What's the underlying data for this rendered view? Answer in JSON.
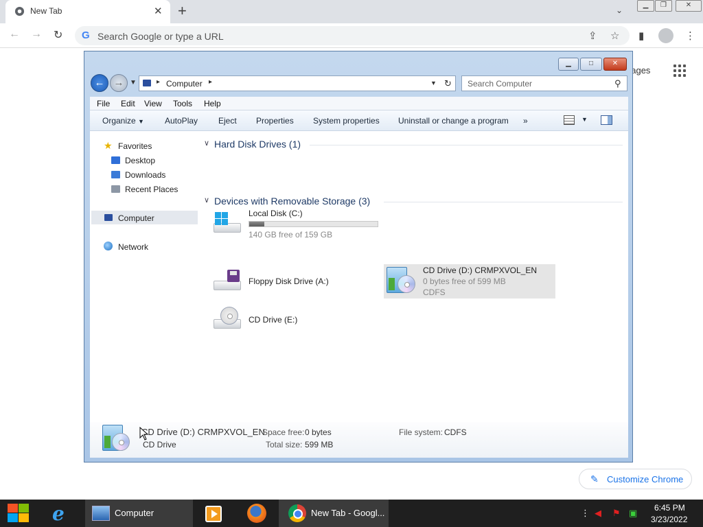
{
  "browser": {
    "tab_title": "New Tab",
    "omnibox_placeholder": "Search Google or type a URL",
    "ntp_images_link": "nages",
    "customize_label": "Customize Chrome"
  },
  "explorer": {
    "address_text": "Computer",
    "search_placeholder": "Search Computer",
    "menu": [
      "File",
      "Edit",
      "View",
      "Tools",
      "Help"
    ],
    "commands": [
      "Organize",
      "AutoPlay",
      "Eject",
      "Properties",
      "System properties",
      "Uninstall or change a program",
      "»"
    ],
    "nav": {
      "favorites": "Favorites",
      "desktop": "Desktop",
      "downloads": "Downloads",
      "recent": "Recent Places",
      "computer": "Computer",
      "network": "Network"
    },
    "groups": {
      "hard_disks": "Hard Disk Drives (1)",
      "removable": "Devices with Removable Storage (3)"
    },
    "drives": {
      "c_name": "Local Disk (C:)",
      "c_free": "140 GB free of 159 GB",
      "c_used_fraction": 0.12,
      "a_name": "Floppy Disk Drive (A:)",
      "d_name": "CD Drive (D:) CRMPXVOL_EN",
      "d_free": "0 bytes free of 599 MB",
      "d_fs": "CDFS",
      "e_name": "CD Drive (E:)"
    },
    "details": {
      "name": "CD Drive (D:) CRMPXVOL_EN",
      "type": "CD Drive",
      "space_free_label": "Space free:",
      "space_free": "0 bytes",
      "total_size_label": "Total size:",
      "total_size": "599 MB",
      "fs_label": "File system:",
      "fs": "CDFS"
    }
  },
  "taskbar": {
    "explorer_label": "Computer",
    "chrome_label": "New Tab - Googl...",
    "time": "6:45 PM",
    "date": "3/23/2022"
  },
  "colors": {
    "chrome_blue": "#1a73e8",
    "explorer_frame": "#a9c5e6",
    "taskbar_bg": "#1f1f1f"
  }
}
